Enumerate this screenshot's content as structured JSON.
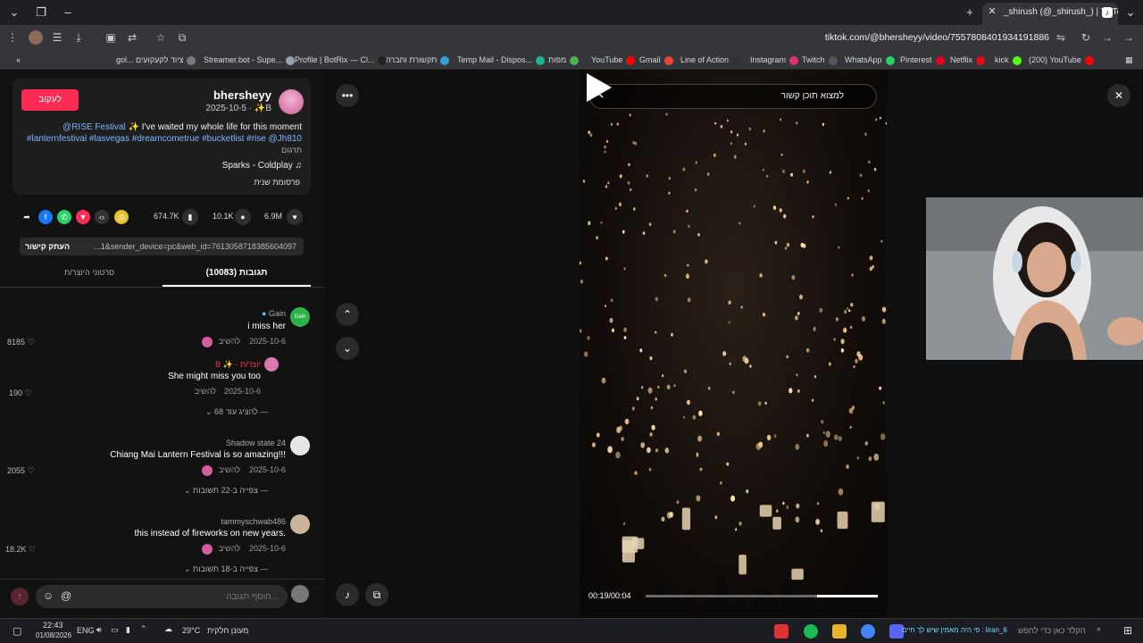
{
  "browser": {
    "tab_title": "_shirush (@_shirush_) | TikTok",
    "url": "tiktok.com/@bhersheyy/video/7557808401934191886",
    "new_tab": "+",
    "bookmarks": [
      {
        "label": "gol... ציוד לקעקועים",
        "color": "#7a7a7a"
      },
      {
        "label": "Streamer.bot - Supe...",
        "color": "#8fa3b5"
      },
      {
        "label": "Profile | BotRix — Cl...",
        "color": "#222"
      },
      {
        "label": "תקשורת וחברה",
        "color": "#33a0d6"
      },
      {
        "label": "Temp Mail - Dispos...",
        "color": "#1fb58f"
      },
      {
        "label": "מפות",
        "color": "#4caf50"
      },
      {
        "label": "YouTube",
        "color": "#ff0000"
      },
      {
        "label": "Gmail",
        "color": "#ea4335"
      },
      {
        "label": "Line of Action",
        "color": "#333"
      },
      {
        "label": "Instagram",
        "color": "#e1306c"
      },
      {
        "label": "Twitch",
        "color": "#555"
      },
      {
        "label": "WhatsApp",
        "color": "#25d366"
      },
      {
        "label": "Pinterest",
        "color": "#e60023"
      },
      {
        "label": "Netflix",
        "color": "#e50914"
      },
      {
        "label": "kick",
        "color": "#53fc18"
      },
      {
        "label": "(200) YouTube",
        "color": "#ff0000"
      }
    ]
  },
  "author": {
    "follow_label": "לעקוב",
    "name": "bhersheyy",
    "sub": "2025-10-5 · ✨B",
    "caption_tag": "@RISE Festival",
    "caption_text": "✨ I've waited my whole life for this moment",
    "caption_tags": "#lanternfestival #lasvegas #dreamcometrue #bucketlist #rise @Jh810",
    "translate": "תרגום",
    "music": "Sparks - Coldplay ♫",
    "paid": "פרסומת שנית"
  },
  "actions": {
    "likes": "6.9M",
    "comments": "10.1K",
    "saves": "674.7K"
  },
  "link": {
    "copy_label": "העתק קישור",
    "text": "...1&sender_device=pc&web_id=7613058718385604097"
  },
  "tabs": {
    "comments": "תגובות (10083)",
    "creator": "סרטוני היוצר/ת"
  },
  "comments": [
    {
      "user": "Gain",
      "text": "i miss her",
      "date": "2025-10-6",
      "reply": "להשיב",
      "likes": "8185",
      "avatar_color": "#2bb34a"
    },
    {
      "user": "B ✨ · יוצר/ת",
      "text": "She might miss you too",
      "date": "2025-10-6",
      "reply": "להשיב",
      "likes": "190",
      "avatar_color": "#d87bb0",
      "more": "להציג עוד 68"
    },
    {
      "user": "Shadow state 24",
      "text": "Chiang Mai Lantern Festival is so amazing!!!",
      "date": "2025-10-6",
      "reply": "להשיב",
      "likes": "2055",
      "avatar_color": "#ddd",
      "more": "צפייה ב-22 תשובות"
    },
    {
      "user": "tammyschwab486",
      "text": "this instead of fireworks on new years.",
      "date": "2025-10-6",
      "reply": "להשיב",
      "likes": "18.2K",
      "avatar_color": "#c9b59b",
      "more": "צפייה ב-18 תשובות"
    }
  ],
  "comment_input": {
    "placeholder": "הוסף תגובה..."
  },
  "video": {
    "search_text": "למצוא תוכן קשור",
    "time": "00:19/00:04",
    "progress": 0.74
  },
  "taskbar": {
    "time": "22:43",
    "date": "01/08/2026",
    "lang": "ENG",
    "weather": "29°C",
    "weather_desc": "מעונן חלקית",
    "search_placeholder": "הקלד כאן כדי לחפש",
    "news": "פי היה מאמין שיש לך חיים : liran_6"
  },
  "colors": {
    "tiktok_red": "#fe2c55",
    "link_blue": "#7db4ff"
  }
}
